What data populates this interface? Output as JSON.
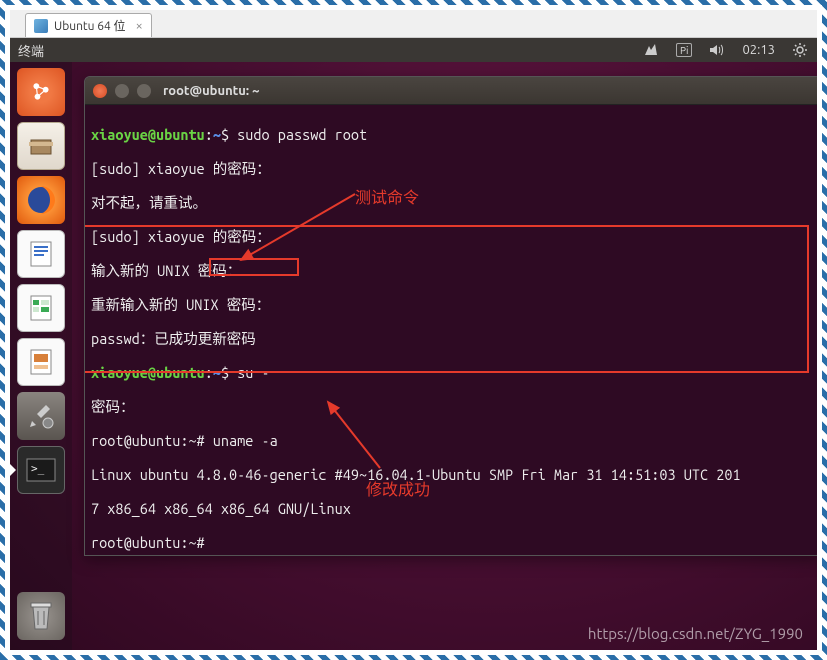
{
  "vm_tab": {
    "label": "Ubuntu 64 位"
  },
  "menubar": {
    "left_label": "终端",
    "keyboard_indicator": "Pi",
    "clock": "02:13"
  },
  "launcher": {
    "items": [
      {
        "name": "dash-icon"
      },
      {
        "name": "files-icon"
      },
      {
        "name": "firefox-icon"
      },
      {
        "name": "libreoffice-writer-icon"
      },
      {
        "name": "libreoffice-calc-icon"
      },
      {
        "name": "libreoffice-impress-icon"
      },
      {
        "name": "settings-icon"
      },
      {
        "name": "terminal-icon"
      },
      {
        "name": "trash-icon"
      }
    ]
  },
  "terminal": {
    "title": "root@ubuntu: ~",
    "lines": {
      "l1_user": "xiaoyue@ubuntu",
      "l1_path": "~",
      "l1_cmd": "$ sudo passwd root",
      "l2": "[sudo] xiaoyue 的密码：",
      "l3": "对不起，请重试。",
      "l4": "[sudo] xiaoyue 的密码：",
      "l5": "输入新的 UNIX 密码：",
      "l6": "重新输入新的 UNIX 密码：",
      "l7": "passwd：已成功更新密码",
      "l8_user": "xiaoyue@ubuntu",
      "l8_path": "~",
      "l8_cmd": "$ su -",
      "l9": "密码：",
      "l10": "root@ubuntu:~# uname -a",
      "l11": "Linux ubuntu 4.8.0-46-generic #49~16.04.1-Ubuntu SMP Fri Mar 31 14:51:03 UTC 201",
      "l12": "7 x86_64 x86_64 x86_64 GNU/Linux",
      "l13": "root@ubuntu:~# "
    }
  },
  "annotations": {
    "test_cmd": "测试命令",
    "modify_success": "修改成功"
  },
  "watermark": "https://blog.csdn.net/ZYG_1990"
}
